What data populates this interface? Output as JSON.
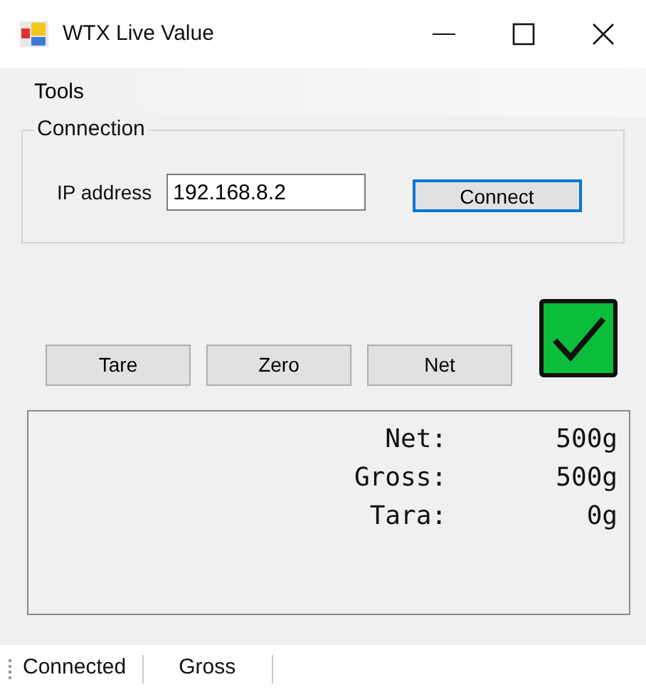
{
  "window": {
    "title": "WTX Live Value"
  },
  "menu": [
    "Tools"
  ],
  "connection": {
    "title": "Connection",
    "ip_label": "IP address",
    "ip_value": "192.168.8.2",
    "connect_button": {
      "label": "Connect",
      "focused": true
    }
  },
  "buttons": [
    "Tare",
    "Zero",
    "Net"
  ],
  "status_indicator": {
    "ok": true
  },
  "readings": [
    {
      "label": "Net:",
      "value": "500g"
    },
    {
      "label": "Gross:",
      "value": "500g"
    },
    {
      "label": "Tara:",
      "value": "0g"
    }
  ],
  "status_bar": [
    "Connected",
    "Gross"
  ]
}
